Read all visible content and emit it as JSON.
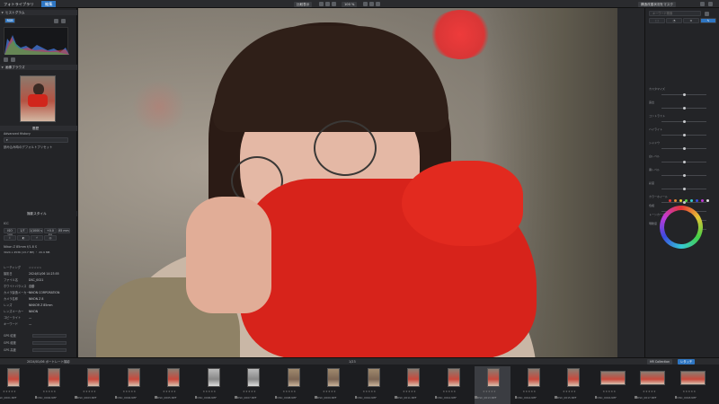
{
  "topbar": {
    "app_title": "フォトライブラリ",
    "tab_edit": "編集",
    "btn_compare": "比較表示",
    "zoom": "100 %",
    "btn_save": "構造改善状況をマスク",
    "right_icons": [
      "user-icon",
      "settings-icon"
    ]
  },
  "left": {
    "histogram_title": "ヒストグラム",
    "histogram_chip": "RGB",
    "navigator_title": "画像ブラウズ",
    "history_title": "履歴",
    "history_section": "Advanced History",
    "history_item": "読み込み時のデフォルトプリセット",
    "shoot_title": "撮影スタイル",
    "preset_title": "ICC",
    "chips": [
      "ISO 100",
      "1/7",
      "1/1000 s",
      "+0.0 EV",
      "85 mm"
    ],
    "device": "Nikon Z 85mm f/1.8 S",
    "device_sub": "3024 x 4536 (13.7 MP) ・ 20.9 MB",
    "fields": [
      {
        "k": "レーティング",
        "v": "☆☆☆☆☆"
      },
      {
        "k": "撮影日",
        "v": "2024/01/06 14:23:55"
      },
      {
        "k": "ファイル名",
        "v": "DSC_0021"
      },
      {
        "k": "ホワイトバランス",
        "v": "自動"
      },
      {
        "k": "カメラ製造メーカー",
        "v": "NIKON CORPORATION"
      },
      {
        "k": "カメラ名称",
        "v": "NIKON Z 8"
      },
      {
        "k": "レンズ",
        "v": "NIKKOR Z 85mm"
      },
      {
        "k": "レンズメーカー",
        "v": "NIKON"
      },
      {
        "k": "コピーライト",
        "v": "—"
      },
      {
        "k": "キーワード",
        "v": "—"
      }
    ],
    "gps": [
      "GPS 緯度",
      "GPS 経度",
      "GPS 高度"
    ]
  },
  "right": {
    "search_placeholder": "キーワード検索",
    "sections": [
      "カスタマイズ",
      "露出",
      "コントラスト",
      "ハイライト",
      "シャドウ",
      "白レベル",
      "黒レベル",
      "彩度",
      "カラーホイール",
      "色相",
      "トーンカーブ",
      "明瞭度"
    ],
    "swatch_colors": [
      "#e53535",
      "#e58a35",
      "#e5d535",
      "#5bd04a",
      "#35c9d6",
      "#3a4be0",
      "#c23ad8",
      "#e0e0e0"
    ]
  },
  "filmstrip": {
    "folder": "2024/01/06 ポートレート撮影",
    "count": "1/23",
    "badge_left": "HR Collection",
    "badge_right": "レタッチ",
    "frames": [
      {
        "cap": "DSC_0001.NEF",
        "kind": "pic"
      },
      {
        "cap": "DSC_0002.NEF",
        "kind": "pic"
      },
      {
        "cap": "DSC_0003.NEF",
        "kind": "pic"
      },
      {
        "cap": "DSC_0004.NEF",
        "kind": "pic"
      },
      {
        "cap": "DSC_0005.NEF",
        "kind": "pic"
      },
      {
        "cap": "DSC_0006.NEF",
        "kind": "mono"
      },
      {
        "cap": "DSC_0007.NEF",
        "kind": "mono"
      },
      {
        "cap": "DSC_0008.NEF",
        "kind": "warm"
      },
      {
        "cap": "DSC_0009.NEF",
        "kind": "warm"
      },
      {
        "cap": "DSC_0010.NEF",
        "kind": "warm"
      },
      {
        "cap": "DSC_0011.NEF",
        "kind": "pic"
      },
      {
        "cap": "DSC_0012.NEF",
        "kind": "pic"
      },
      {
        "cap": "DSC_0013.NEF",
        "kind": "pic"
      },
      {
        "cap": "DSC_0014.NEF",
        "kind": "pic"
      },
      {
        "cap": "DSC_0015.NEF",
        "kind": "pic"
      },
      {
        "cap": "DSC_0016.NEF",
        "kind": "wide"
      },
      {
        "cap": "DSC_0017.NEF",
        "kind": "wide"
      },
      {
        "cap": "DSC_0018.NEF",
        "kind": "wide"
      }
    ]
  }
}
